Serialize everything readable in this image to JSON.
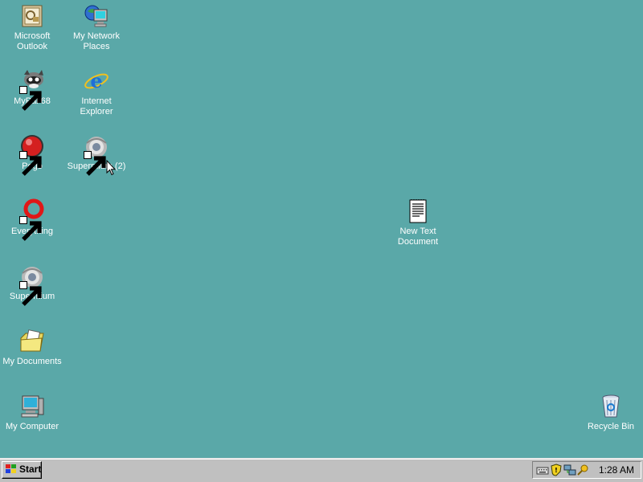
{
  "desktop": {
    "background": "#5aa8a8",
    "icons": [
      {
        "label": "Microsoft\nOutlook",
        "icon": "outlook-icon"
      },
      {
        "label": "My Network\nPlaces",
        "icon": "network-places-icon"
      },
      {
        "label": "MyPal 68",
        "icon": "mypal-icon"
      },
      {
        "label": "Internet\nExplorer",
        "icon": "internet-explorer-icon"
      },
      {
        "label": "Pego",
        "icon": "pego-icon"
      },
      {
        "label": "Supermium (2)",
        "icon": "supermium-icon"
      },
      {
        "label": "Everything",
        "icon": "everything-icon"
      },
      {
        "label": "Supermium",
        "icon": "supermium-icon"
      },
      {
        "label": "My Documents",
        "icon": "my-documents-icon"
      },
      {
        "label": "My Computer",
        "icon": "my-computer-icon"
      },
      {
        "label": "New Text\nDocument",
        "icon": "text-document-icon"
      },
      {
        "label": "Recycle Bin",
        "icon": "recycle-bin-icon"
      }
    ]
  },
  "taskbar": {
    "start_label": "Start",
    "clock": "1:28 AM",
    "tray_icons": [
      "keyboard-icon",
      "security-shield-icon",
      "network-icon",
      "search-key-icon"
    ]
  }
}
